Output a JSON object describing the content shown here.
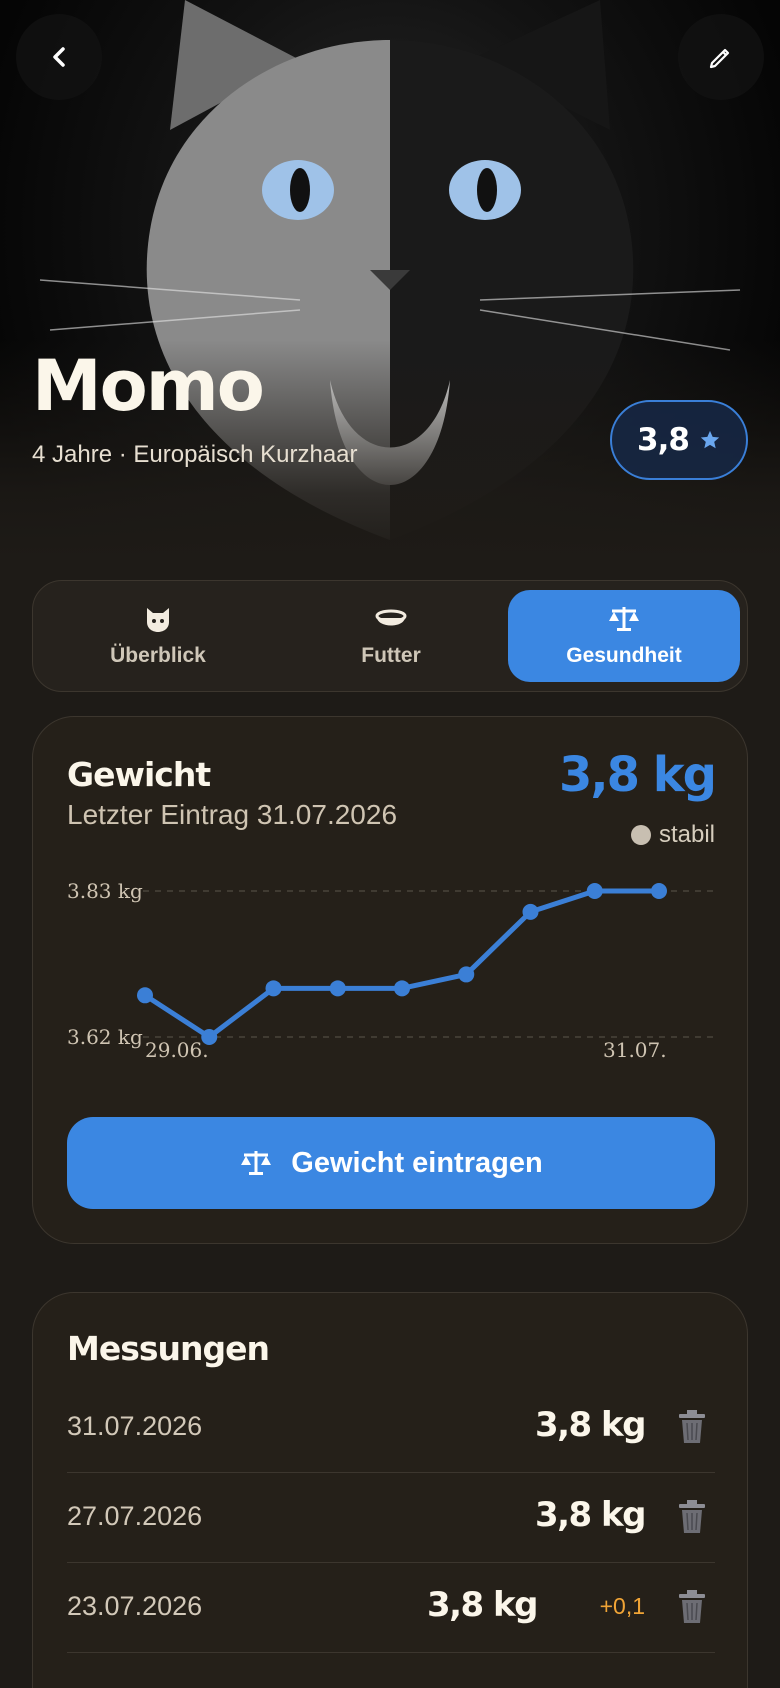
{
  "pet": {
    "name": "Momo",
    "subtitle": "4 Jahre · Europäisch Kurzhaar",
    "rating": "3,8"
  },
  "tabs": [
    {
      "label": "Überblick",
      "icon": "cat-face-icon",
      "active": false
    },
    {
      "label": "Futter",
      "icon": "bowl-icon",
      "active": false
    },
    {
      "label": "Gesundheit",
      "icon": "scale-icon",
      "active": true
    }
  ],
  "weight": {
    "title": "Gewicht",
    "last_entry": "Letzter Eintrag 31.07.2026",
    "current": "3,8 kg",
    "trend": "stabil",
    "button_label": "Gewicht eintragen"
  },
  "chart_data": {
    "type": "line",
    "x_labels": [
      "29.06.",
      "31.07."
    ],
    "y_labels": [
      "3.83 kg",
      "3.62 kg"
    ],
    "values": [
      3.68,
      3.62,
      3.69,
      3.69,
      3.69,
      3.71,
      3.8,
      3.83,
      3.83
    ],
    "ylim": [
      3.62,
      3.83
    ],
    "grid": true
  },
  "measurements": {
    "title": "Messungen",
    "rows": [
      {
        "date": "31.07.2026",
        "weight": "3,8 kg",
        "delta": ""
      },
      {
        "date": "27.07.2026",
        "weight": "3,8 kg",
        "delta": ""
      },
      {
        "date": "23.07.2026",
        "weight": "3,8 kg",
        "delta": "+0,1"
      },
      {
        "date": "",
        "weight": "",
        "delta": ""
      }
    ]
  },
  "colors": {
    "accent": "#3b87e2",
    "background": "#1e1b17",
    "card": "#252019",
    "positive_delta": "#f0a436"
  }
}
